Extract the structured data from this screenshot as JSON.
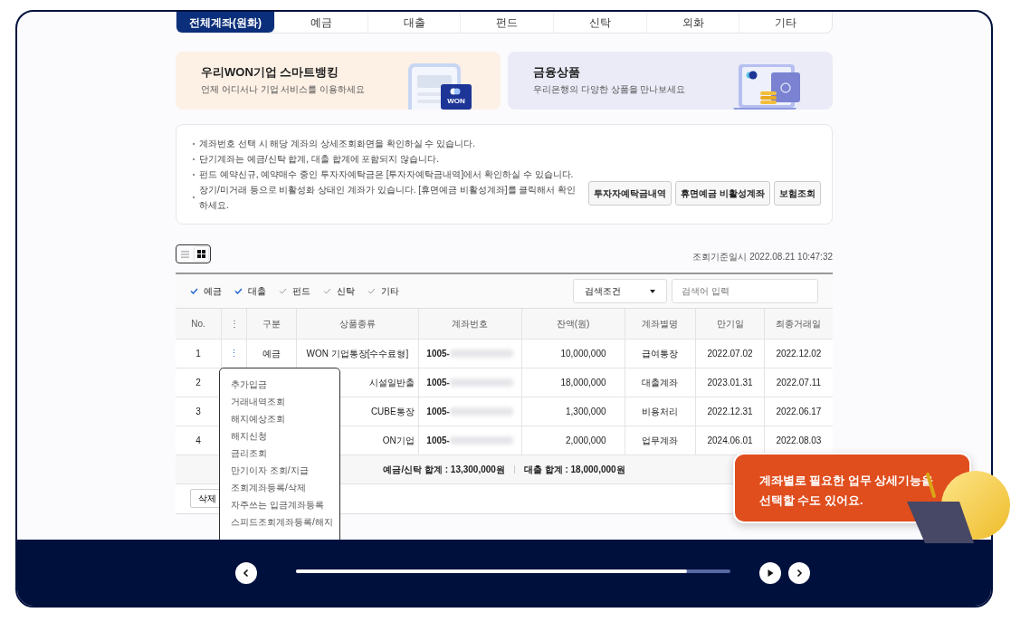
{
  "tabs": [
    {
      "label": "전체계좌(원화)",
      "selected": true
    },
    {
      "label": "예금",
      "selected": false
    },
    {
      "label": "대출",
      "selected": false
    },
    {
      "label": "펀드",
      "selected": false
    },
    {
      "label": "신탁",
      "selected": false
    },
    {
      "label": "외화",
      "selected": false
    },
    {
      "label": "기타",
      "selected": false
    }
  ],
  "promos": [
    {
      "kind": "phone",
      "title": "우리WON기업 스마트뱅킹",
      "subtitle": "언제 어디서나 기업 서비스를 이용하세요",
      "badge": "WON"
    },
    {
      "kind": "safe",
      "title": "금융상품",
      "subtitle": "우리은행의 다양한 상품을 만나보세요"
    }
  ],
  "notices": [
    "계좌번호 선택 시 해당 계좌의 상세조회화면을 확인하실 수 있습니다.",
    "단기계좌는 예금/신탁 합계, 대출 합계에 포함되지 않습니다.",
    "펀드 예약신규, 예약매수 중인 투자자예탁금은 [투자자예탁금내역]에서 확인하실 수 있습니다.",
    "장기/미거래 등으로 비활성화 상태인 계좌가 있습니다. [휴면예금 비활성계좌]를 클릭해서 확인하세요."
  ],
  "notice_buttons": [
    "투자자예탁금내역",
    "휴면예금 비활성계좌",
    "보험조회"
  ],
  "view_toggle": [
    {
      "kind": "list",
      "selected": false
    },
    {
      "kind": "grid",
      "selected": true
    }
  ],
  "timestamp": "조회기준일시 2022.08.21 10:47:32",
  "filters": [
    {
      "label": "예금",
      "checked": true
    },
    {
      "label": "대출",
      "checked": true
    },
    {
      "label": "펀드",
      "checked": false
    },
    {
      "label": "신탁",
      "checked": false
    },
    {
      "label": "기타",
      "checked": false
    }
  ],
  "search": {
    "condition": "검색조건",
    "placeholder": "검색어 입력"
  },
  "table": {
    "columns": [
      "No.",
      "⋮",
      "구분",
      "상품종류",
      "계좌번호",
      "잔액(원)",
      "계좌별명",
      "만기일",
      "최종거래일"
    ],
    "rows": [
      {
        "no": "1",
        "menu_open": true,
        "type": "예금",
        "product": "WON 기업통장[수수료형]",
        "account": "1005-",
        "balance": "10,000,000",
        "alias": "급여통장",
        "maturity": "2022.07.02",
        "last": "2022.12.02"
      },
      {
        "no": "2",
        "product": "시설일반출",
        "account": "1005-",
        "balance": "18,000,000",
        "alias": "대출계좌",
        "maturity": "2023.01.31",
        "last": "2022.07.11"
      },
      {
        "no": "3",
        "product": "CUBE통장",
        "account": "1005-",
        "balance": "1,300,000",
        "alias": "비용처리",
        "maturity": "2022.12.31",
        "last": "2022.06.17"
      },
      {
        "no": "4",
        "product": "ON기업",
        "account": "1005-",
        "balance": "2,000,000",
        "alias": "업무계좌",
        "maturity": "2024.06.01",
        "last": "2022.08.03"
      }
    ],
    "totals": [
      "예금/신탁 합계 : 13,300,000원",
      "대출 합계 : 18,000,000원"
    ]
  },
  "delete_button": "삭제",
  "row_menu": [
    "추가입금",
    "거래내역조회",
    "해지예상조회",
    "해지신청",
    "금리조회",
    "만기이자 조회/지급",
    "조회계좌등록/삭제",
    "자주쓰는 입금계좌등록",
    "스피드조회계좌등록/해지"
  ],
  "tooltip": "계좌별로 필요한 업무 상세기능을\n선택할 수도 있어요.",
  "player": {
    "level": 0.9
  }
}
